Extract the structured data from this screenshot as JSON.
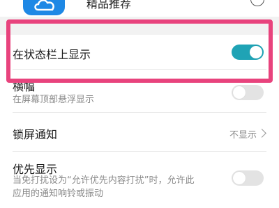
{
  "app": {
    "name": "精品推荐",
    "icon": "cloud-icon",
    "info_icon": "info-icon"
  },
  "settings": [
    {
      "label": "在状态栏上显示",
      "toggle": "on"
    },
    {
      "label": "横幅",
      "sub": "在屏幕顶部悬浮显示",
      "toggle": "off"
    },
    {
      "label": "锁屏通知",
      "value": "不显示"
    },
    {
      "label": "优先显示",
      "sub_line1": "当免打扰设为“允许优先内容打扰”时，允许此",
      "sub_line2": "应用的通知响铃或振动",
      "toggle": "off"
    }
  ],
  "colors": {
    "accent": "#1fa3b5",
    "highlight": "#e8437d",
    "icon_bg": "#1e88e5"
  }
}
